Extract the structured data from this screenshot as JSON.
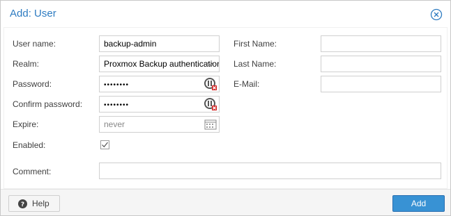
{
  "dialog": {
    "title": "Add: User",
    "close_icon": "close-circle-icon",
    "accent_color": "#2d7bc1"
  },
  "form": {
    "username_label": "User name:",
    "username_value": "backup-admin",
    "realm_label": "Realm:",
    "realm_value": "Proxmox Backup authentication server",
    "password_label": "Password:",
    "password_value": "••••••••",
    "confirm_password_label": "Confirm password:",
    "confirm_password_value": "••••••••",
    "expire_label": "Expire:",
    "expire_placeholder": "never",
    "enabled_label": "Enabled:",
    "enabled_checked": true,
    "comment_label": "Comment:",
    "comment_value": "",
    "firstname_label": "First Name:",
    "firstname_value": "",
    "lastname_label": "Last Name:",
    "lastname_value": "",
    "email_label": "E-Mail:",
    "email_value": ""
  },
  "footer": {
    "help_label": "Help",
    "add_label": "Add",
    "add_button_color": "#3892d4"
  }
}
